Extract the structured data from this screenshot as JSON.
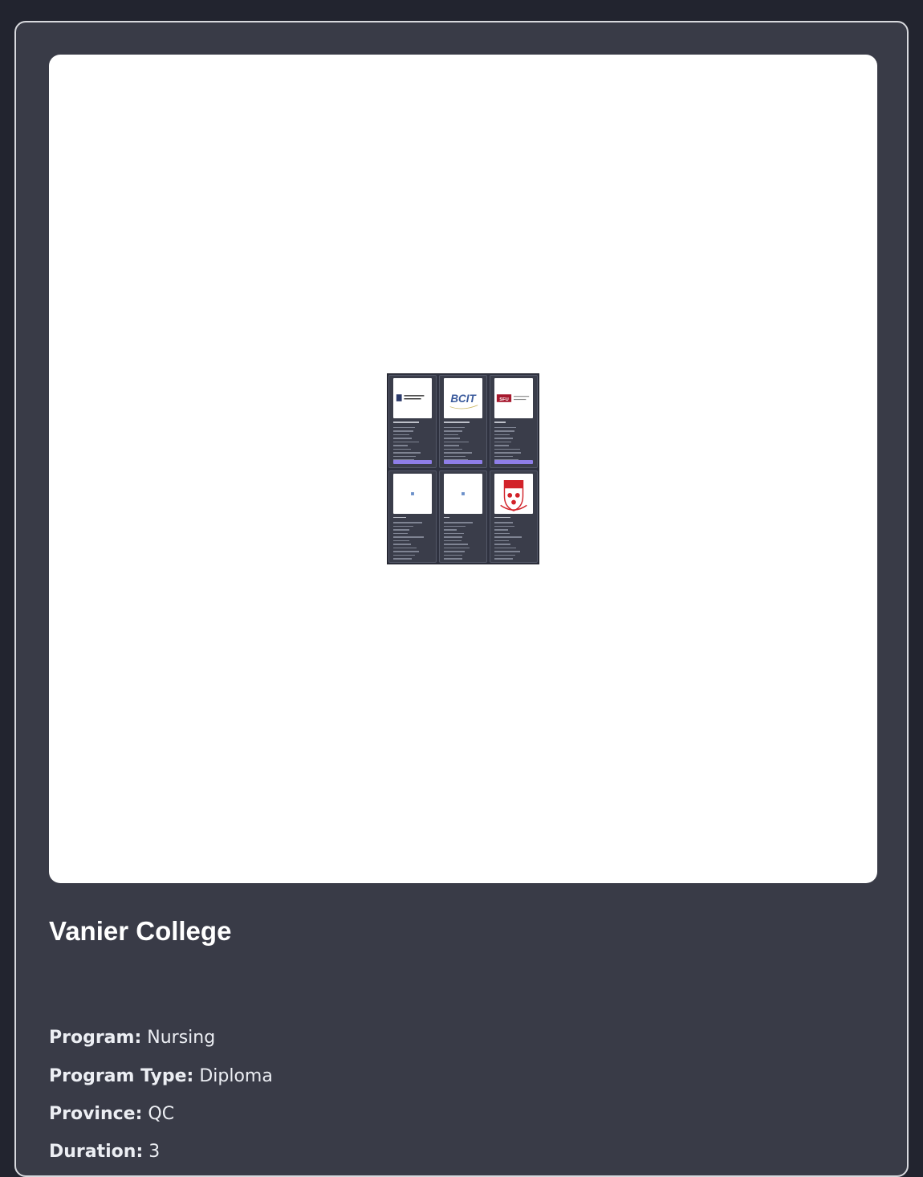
{
  "card": {
    "logo_alt": "Vanier College logo",
    "thumbnail_cards": [
      {
        "logo": "university-crest-logo"
      },
      {
        "logo": "bcit-logo",
        "logo_text": "BCIT"
      },
      {
        "logo": "sfu-logo",
        "logo_text": "SFU"
      },
      {
        "logo": "placeholder-logo"
      },
      {
        "logo": "placeholder-logo"
      },
      {
        "logo": "mcgill-crest-logo"
      }
    ],
    "title": "Vanier College",
    "details": [
      {
        "label": "Program:",
        "value": "Nursing"
      },
      {
        "label": "Program Type:",
        "value": "Diploma"
      },
      {
        "label": "Province:",
        "value": "QC"
      },
      {
        "label": "Duration:",
        "value": "3"
      }
    ]
  },
  "colors": {
    "page_background": "#22242f",
    "card_background": "#393b47",
    "card_border": "#d8d9de",
    "button_accent": "#8e7ee8"
  }
}
